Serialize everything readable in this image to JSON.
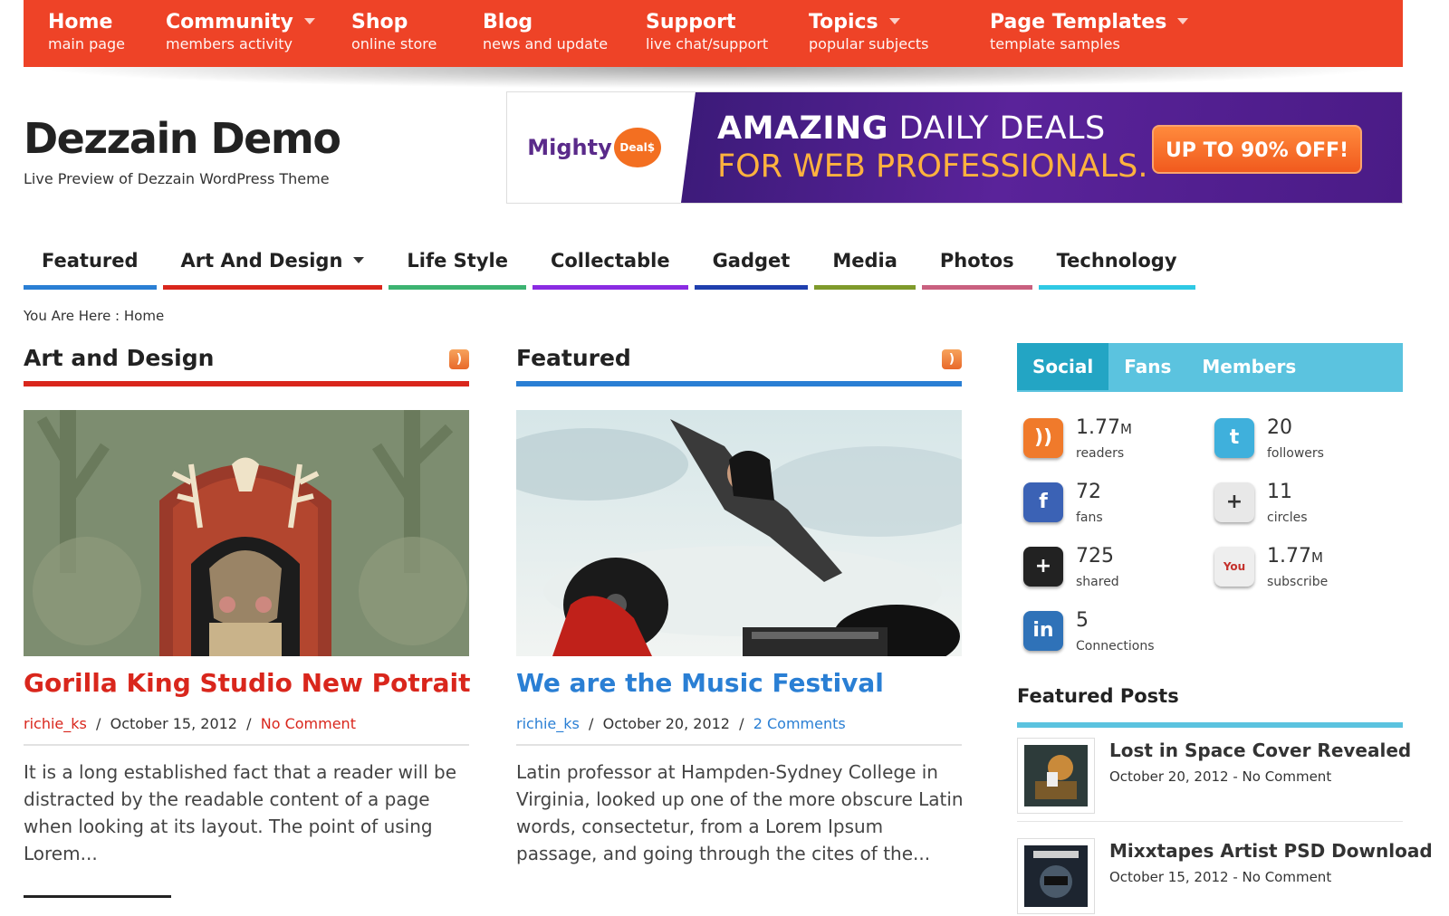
{
  "topnav": [
    {
      "title": "Home",
      "sub": "main page",
      "dropdown": false
    },
    {
      "title": "Community",
      "sub": "members activity",
      "dropdown": true
    },
    {
      "title": "Shop",
      "sub": "online store",
      "dropdown": false
    },
    {
      "title": "Blog",
      "sub": "news and update",
      "dropdown": false
    },
    {
      "title": "Support",
      "sub": "live chat/support",
      "dropdown": false
    },
    {
      "title": "Topics",
      "sub": "popular subjects",
      "dropdown": true
    },
    {
      "title": "Page Templates",
      "sub": "template samples",
      "dropdown": true
    }
  ],
  "site": {
    "title": "Dezzain Demo",
    "tagline": "Live Preview of Dezzain WordPress Theme"
  },
  "banner": {
    "logo_text": "Mighty",
    "logo_badge": "Deal$",
    "line1_bold": "AMAZING",
    "line1_rest": " DAILY DEALS",
    "line2": "FOR WEB PROFESSIONALS.",
    "cta": "UP TO 90% OFF!"
  },
  "categories": [
    {
      "label": "Featured",
      "color": "#2a7fd4",
      "dropdown": false
    },
    {
      "label": "Art And Design",
      "color": "#d9261c",
      "dropdown": true
    },
    {
      "label": "Life Style",
      "color": "#3cb371",
      "dropdown": false
    },
    {
      "label": "Collectable",
      "color": "#8a2be2",
      "dropdown": false
    },
    {
      "label": "Gadget",
      "color": "#1f3fae",
      "dropdown": false
    },
    {
      "label": "Media",
      "color": "#7f9a2b",
      "dropdown": false
    },
    {
      "label": "Photos",
      "color": "#c9607f",
      "dropdown": false
    },
    {
      "label": "Technology",
      "color": "#2fc9e4",
      "dropdown": false
    }
  ],
  "breadcrumb": {
    "prefix": "You Are Here :",
    "current": "Home"
  },
  "columns": [
    {
      "heading": "Art and Design",
      "accent": "#d9261c",
      "post_title": "Gorilla King Studio New Potrait",
      "author": "richie_ks",
      "date": "October 15, 2012",
      "comments": "No Comment",
      "excerpt": "It is a long established fact that a reader will be distracted by the readable content of a page when looking at its layout. The point of using Lorem..."
    },
    {
      "heading": "Featured",
      "accent": "#2a7fd4",
      "post_title": "We are the Music Festival",
      "author": "richie_ks",
      "date": "October 20, 2012",
      "comments": "2 Comments",
      "excerpt": "Latin professor at Hampden-Sydney College in Virginia, looked up one of the more obscure Latin words, consectetur, from a Lorem Ipsum passage, and going through the cites of the..."
    }
  ],
  "sidebar": {
    "tabs": [
      "Social",
      "Fans",
      "Members"
    ],
    "social": [
      {
        "icon": "rss-icon",
        "glyph": "))",
        "num": "1.77",
        "unit": "M",
        "label": "readers",
        "color": "#f07a2b"
      },
      {
        "icon": "twitter-icon",
        "glyph": "t",
        "num": "20",
        "unit": "",
        "label": "followers",
        "color": "#3fb0dc"
      },
      {
        "icon": "facebook-icon",
        "glyph": "f",
        "num": "72",
        "unit": "",
        "label": "fans",
        "color": "#3b62b5"
      },
      {
        "icon": "google-circles-icon",
        "glyph": "+",
        "num": "11",
        "unit": "",
        "label": "circles",
        "color": "#e8e8e8"
      },
      {
        "icon": "google-share-icon",
        "glyph": "+",
        "num": "725",
        "unit": "",
        "label": "shared",
        "color": "#222222"
      },
      {
        "icon": "youtube-icon",
        "glyph": "You",
        "num": "1.77",
        "unit": "M",
        "label": "subscribe",
        "color": "#eeeeee"
      },
      {
        "icon": "linkedin-icon",
        "glyph": "in",
        "num": "5",
        "unit": "",
        "label": "Connections",
        "color": "#2f72b8"
      }
    ],
    "featured_title": "Featured Posts",
    "featured_posts": [
      {
        "title": "Lost in Space Cover Revealed",
        "meta": "October 20, 2012 - No Comment"
      },
      {
        "title": "Mixxtapes Artist PSD Download",
        "meta": "October 15, 2012 - No Comment"
      }
    ]
  },
  "rss_glyph": ")"
}
